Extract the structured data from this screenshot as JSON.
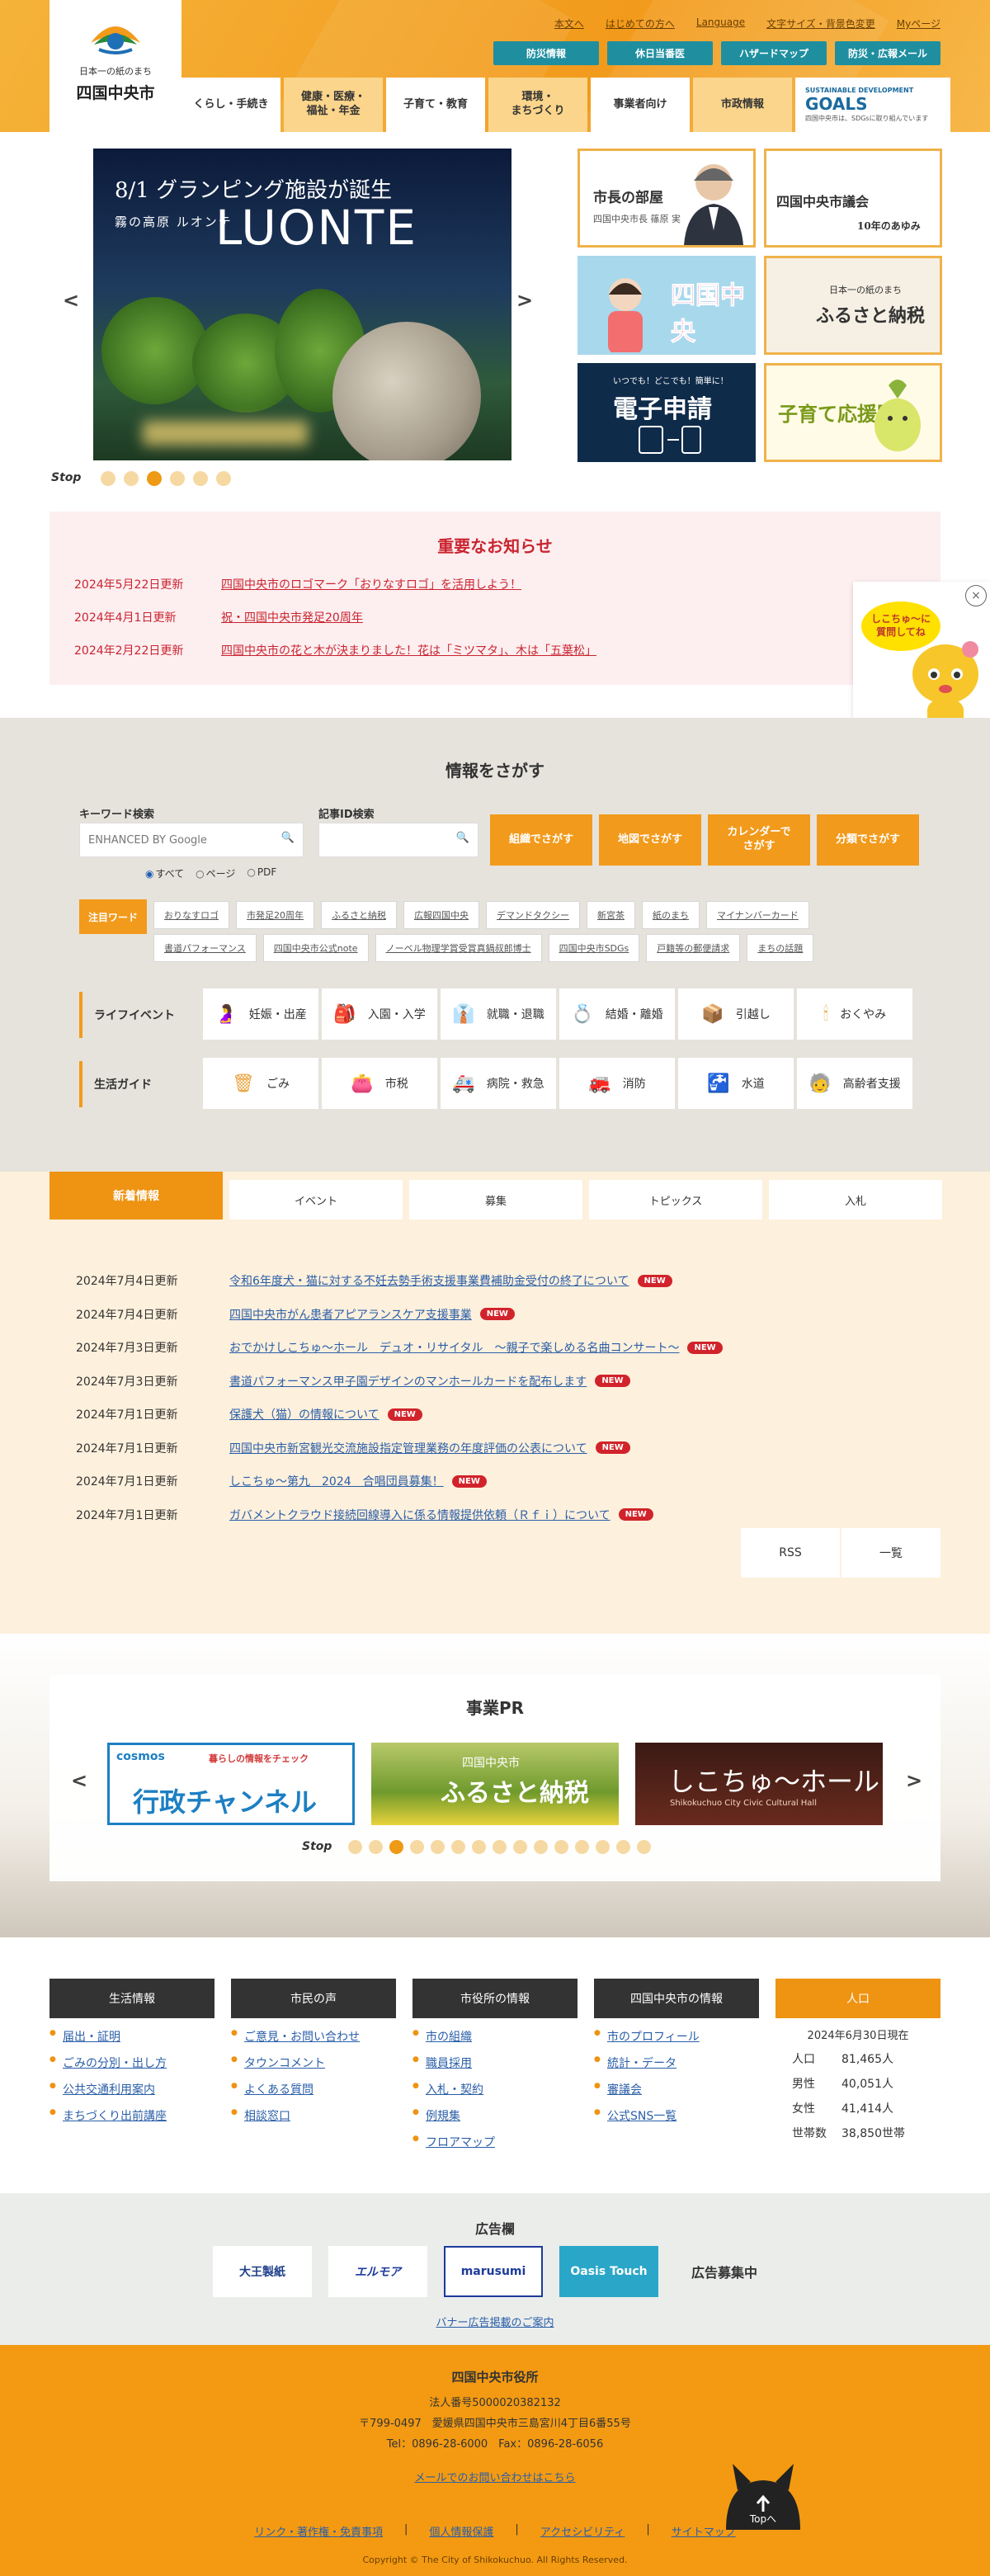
{
  "header": {
    "logo_tag": "日本一の紙のまち",
    "logo_name": "四国中央市",
    "top_links": [
      "本文へ",
      "はじめての方へ",
      "Language",
      "文字サイズ・背景色変更",
      "Myページ"
    ],
    "quick": [
      "防災情報",
      "休日当番医",
      "ハザードマップ",
      "防災・広報メール"
    ],
    "nav": [
      "くらし・手続き",
      "健康・医療・\n福祉・年金",
      "子育て・教育",
      "環境・\nまちづくり",
      "事業者向け",
      "市政情報"
    ],
    "sdgs_top": "SUSTAINABLE DEVELOPMENT",
    "sdgs_goals": "GOALS",
    "sdgs_sub": "四国中央市は、SDGsに取り組んでいます"
  },
  "hero": {
    "prev": "<",
    "next": ">",
    "slide_date": "8/1 グランピング施設が誕生",
    "slide_sub": "霧の高原 ルオンテ",
    "slide_name": "LUONTE",
    "stop": "Stop",
    "dots": 6,
    "active_dot": 3,
    "tiles": [
      {
        "title": "市長の部屋",
        "sub": "四国中央市長 篠原 実"
      },
      {
        "title": "四国中央市議会",
        "sub": "10年のあゆみ"
      },
      {
        "title": "四国中央",
        "sub": ""
      },
      {
        "title": "ふるさと納税",
        "sub": "日本一の紙のまち"
      },
      {
        "title": "電子申請",
        "sub": "いつでも！どこでも！簡単に！"
      },
      {
        "title": "子育て応援隊",
        "sub": ""
      }
    ]
  },
  "notice": {
    "title": "重要なお知らせ",
    "items": [
      {
        "date": "2024年5月22日更新",
        "text": "四国中央市のロゴマーク「おりなすロゴ」を活用しよう！"
      },
      {
        "date": "2024年4月1日更新",
        "text": "祝・四国中央市発足20周年"
      },
      {
        "date": "2024年2月22日更新",
        "text": "四国中央市の花と木が決まりました！花は「ミツマタ」、木は「五葉松」"
      }
    ]
  },
  "side_ad": {
    "text": "しこちゅ～に\n質問してね",
    "close": "×"
  },
  "search": {
    "title": "情報をさがす",
    "keyword_label": "キーワード検索",
    "keyword_placeholder": "ENHANCED BY Google",
    "id_label": "記事ID検索",
    "radios": [
      "すべて",
      "ページ",
      "PDF"
    ],
    "buttons": [
      "組織でさがす",
      "地図でさがす",
      "カレンダーで\nさがす",
      "分類でさがす"
    ],
    "tag_label": "注目ワード",
    "tags": [
      "おりなすロゴ",
      "市発足20周年",
      "ふるさと納税",
      "広報四国中央",
      "デマンドタクシー",
      "新宮茶",
      "紙のまち",
      "マイナンバーカード",
      "書道パフォーマンス",
      "四国中央市公式note",
      "ノーベル物理学賞受賞真鍋叔郎博士",
      "四国中央市SDGs",
      "戸籍等の郵便請求",
      "まちの話題"
    ],
    "life_event_label": "ライフイベント",
    "life_events": [
      "妊娠・出産",
      "入園・入学",
      "就職・退職",
      "結婚・離婚",
      "引越し",
      "おくやみ"
    ],
    "guide_label": "生活ガイド",
    "guides": [
      "ごみ",
      "市税",
      "病院・救急",
      "消防",
      "水道",
      "高齢者支援"
    ]
  },
  "news": {
    "tabs": [
      "新着情報",
      "イベント",
      "募集",
      "トピックス",
      "入札"
    ],
    "new_label": "NEW",
    "items": [
      {
        "date": "2024年7月4日更新",
        "text": "令和6年度犬・猫に対する不妊去勢手術支援事業費補助金受付の終了について"
      },
      {
        "date": "2024年7月4日更新",
        "text": "四国中央市がん患者アピアランスケア支援事業"
      },
      {
        "date": "2024年7月3日更新",
        "text": "おでかけしこちゅ～ホール　デュオ・リサイタル　～親子で楽しめる名曲コンサート～"
      },
      {
        "date": "2024年7月3日更新",
        "text": "書道パフォーマンス甲子園デザインのマンホールカードを配布します"
      },
      {
        "date": "2024年7月1日更新",
        "text": "保護犬（猫）の情報について"
      },
      {
        "date": "2024年7月1日更新",
        "text": "四国中央市新宮観光交流施設指定管理業務の年度評価の公表について"
      },
      {
        "date": "2024年7月1日更新",
        "text": "しこちゅ～第九　2024　合唱団員募集！"
      },
      {
        "date": "2024年7月1日更新",
        "text": "ガバメントクラウド接続回線導入に係る情報提供依頼（Ｒｆｉ）について"
      }
    ],
    "rss": "RSS",
    "list": "一覧"
  },
  "pr": {
    "title": "事業PR",
    "banners": [
      {
        "brand": "cosmos",
        "catch": "暮らしの情報をチェック",
        "main": "行政チャンネル"
      },
      {
        "brand": "四国中央市",
        "catch": "",
        "main": "ふるさと納税"
      },
      {
        "brand": "Shikokuchuo City Civic Cultural Hall",
        "catch": "",
        "main": "しこちゅ～ホール"
      }
    ],
    "stop": "Stop",
    "dots": 15,
    "active_dot": 3
  },
  "footer_links": {
    "cols": [
      {
        "title": "生活情報",
        "items": [
          "届出・証明",
          "ごみの分別・出し方",
          "公共交通利用案内",
          "まちづくり出前講座"
        ]
      },
      {
        "title": "市民の声",
        "items": [
          "ご意見・お問い合わせ",
          "タウンコメント",
          "よくある質問",
          "相談窓口"
        ]
      },
      {
        "title": "市役所の情報",
        "items": [
          "市の組織",
          "職員採用",
          "入札・契約",
          "例規集",
          "フロアマップ"
        ]
      },
      {
        "title": "四国中央市の情報",
        "items": [
          "市のプロフィール",
          "統計・データ",
          "審議会",
          "公式SNS一覧"
        ]
      }
    ],
    "population": {
      "title": "人口",
      "as_of": "2024年6月30日現在",
      "rows": [
        {
          "k": "人口",
          "v": "81,465人"
        },
        {
          "k": "男性",
          "v": "40,051人"
        },
        {
          "k": "女性",
          "v": "41,414人"
        },
        {
          "k": "世帯数",
          "v": "38,850世帯"
        }
      ]
    }
  },
  "ads": {
    "title": "広告欄",
    "items": [
      "大王製紙",
      "エルモア",
      "marusumi",
      "Oasis Touch",
      "広告募集中"
    ],
    "link": "バナー広告掲載のご案内"
  },
  "office": {
    "name": "四国中央市役所",
    "corp": "法人番号5000020382132",
    "address": "〒799-0497　愛媛県四国中央市三島宮川4丁目6番55号",
    "tel": "Tel：0896-28-6000　Fax：0896-28-6056",
    "mail": "メールでのお問い合わせはこちら",
    "links": [
      "リンク・著作権・免責事項",
      "個人情報保護",
      "アクセシビリティ",
      "サイトマップ"
    ],
    "copyright": "Copyright © The City of Shikokuchuo. All Rights Reserved.",
    "top": "Topへ"
  }
}
